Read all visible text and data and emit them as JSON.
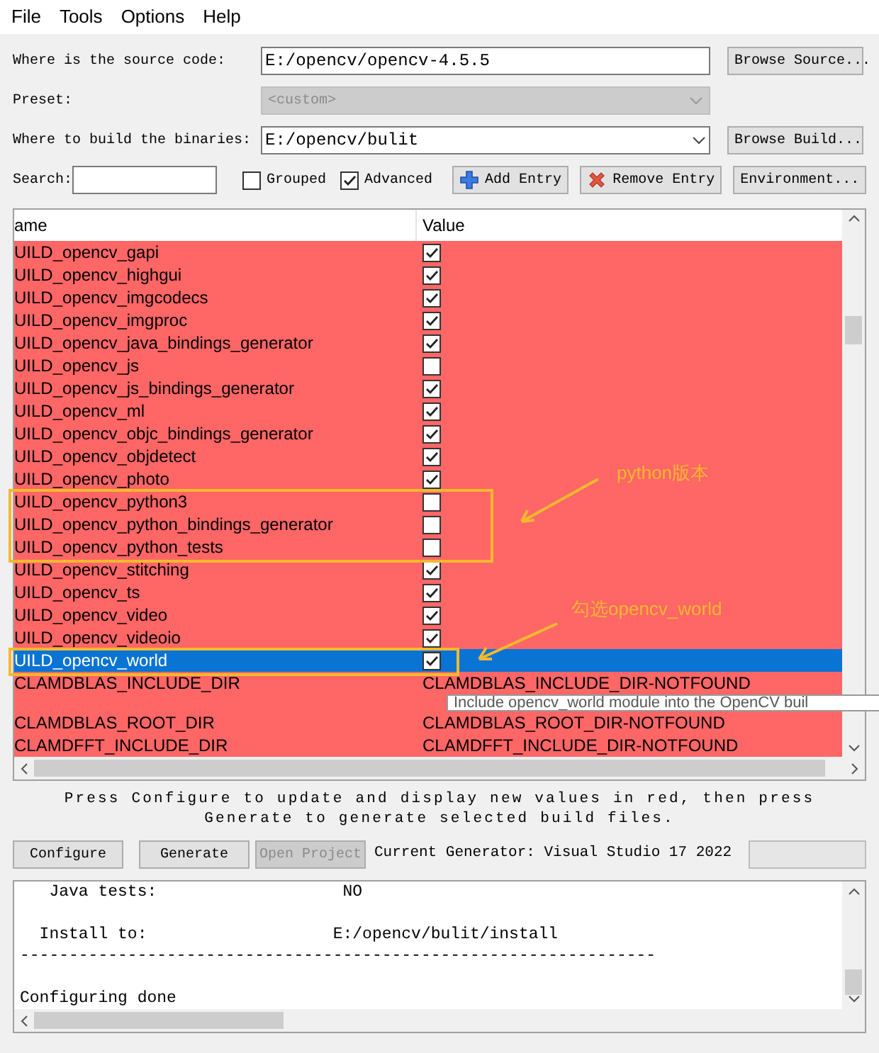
{
  "menu": [
    "File",
    "Tools",
    "Options",
    "Help"
  ],
  "source": {
    "label": "Where is the source code:",
    "value": "E:/opencv/opencv-4.5.5",
    "button": "Browse Source..."
  },
  "preset": {
    "label": "Preset:",
    "value": "<custom>",
    "disabled": true
  },
  "build": {
    "label": "Where to build the binaries:",
    "value": "E:/opencv/bulit",
    "button": "Browse Build..."
  },
  "search": {
    "label": "Search:"
  },
  "options": [
    {
      "label": "Grouped",
      "checked": false
    },
    {
      "label": "Advanced",
      "checked": true
    }
  ],
  "toolbar": [
    {
      "label": "Add Entry",
      "kind": "add"
    },
    {
      "label": "Remove Entry",
      "kind": "remove"
    },
    {
      "label": "Environment...",
      "kind": "plain"
    }
  ],
  "table": {
    "columns": [
      "ame",
      "Value"
    ],
    "rows": [
      {
        "name": "UILD_opencv_gapi",
        "kind": "bool",
        "checked": true,
        "selected": false
      },
      {
        "name": "UILD_opencv_highgui",
        "kind": "bool",
        "checked": true,
        "selected": false
      },
      {
        "name": "UILD_opencv_imgcodecs",
        "kind": "bool",
        "checked": true,
        "selected": false
      },
      {
        "name": "UILD_opencv_imgproc",
        "kind": "bool",
        "checked": true,
        "selected": false
      },
      {
        "name": "UILD_opencv_java_bindings_generator",
        "kind": "bool",
        "checked": true,
        "selected": false
      },
      {
        "name": "UILD_opencv_js",
        "kind": "bool",
        "checked": false,
        "selected": false
      },
      {
        "name": "UILD_opencv_js_bindings_generator",
        "kind": "bool",
        "checked": true,
        "selected": false
      },
      {
        "name": "UILD_opencv_ml",
        "kind": "bool",
        "checked": true,
        "selected": false
      },
      {
        "name": "UILD_opencv_objc_bindings_generator",
        "kind": "bool",
        "checked": true,
        "selected": false
      },
      {
        "name": "UILD_opencv_objdetect",
        "kind": "bool",
        "checked": true,
        "selected": false
      },
      {
        "name": "UILD_opencv_photo",
        "kind": "bool",
        "checked": true,
        "selected": false
      },
      {
        "name": "UILD_opencv_python3",
        "kind": "bool",
        "checked": false,
        "selected": false
      },
      {
        "name": "UILD_opencv_python_bindings_generator",
        "kind": "bool",
        "checked": false,
        "selected": false
      },
      {
        "name": "UILD_opencv_python_tests",
        "kind": "bool",
        "checked": false,
        "selected": false
      },
      {
        "name": "UILD_opencv_stitching",
        "kind": "bool",
        "checked": true,
        "selected": false
      },
      {
        "name": "UILD_opencv_ts",
        "kind": "bool",
        "checked": true,
        "selected": false
      },
      {
        "name": "UILD_opencv_video",
        "kind": "bool",
        "checked": true,
        "selected": false
      },
      {
        "name": "UILD_opencv_videoio",
        "kind": "bool",
        "checked": true,
        "selected": false
      },
      {
        "name": "UILD_opencv_world",
        "kind": "bool",
        "checked": true,
        "selected": true
      },
      {
        "name": "CLAMDBLAS_INCLUDE_DIR",
        "kind": "text",
        "value": "CLAMDBLAS_INCLUDE_DIR-NOTFOUND",
        "selected": false
      },
      {
        "name": "CLAMDBLAS_ROOT_DIR",
        "kind": "text",
        "value": "CLAMDBLAS_ROOT_DIR-NOTFOUND",
        "selected": false
      },
      {
        "name": "CLAMDFFT_INCLUDE_DIR",
        "kind": "text",
        "value": "CLAMDFFT_INCLUDE_DIR-NOTFOUND",
        "selected": false
      }
    ]
  },
  "tooltip": "Include opencv_world module into the OpenCV buil",
  "annotations": [
    {
      "text": "python版本"
    },
    {
      "text": "勾选opencv_world"
    }
  ],
  "hint": "Press Configure to update and display new values in red, then press Generate to generate selected build files.",
  "actions": [
    {
      "label": "Configure",
      "disabled": false
    },
    {
      "label": "Generate",
      "disabled": false
    },
    {
      "label": "Open Project",
      "disabled": true
    }
  ],
  "generator": "Current Generator: Visual Studio 17 2022",
  "output": [
    [
      "   Java tests:                   NO"
    ],
    [
      "  Install to:                   E:/opencv/bulit/install",
      "-----------------------------------------------------------------"
    ],
    [
      "Configuring done"
    ]
  ]
}
